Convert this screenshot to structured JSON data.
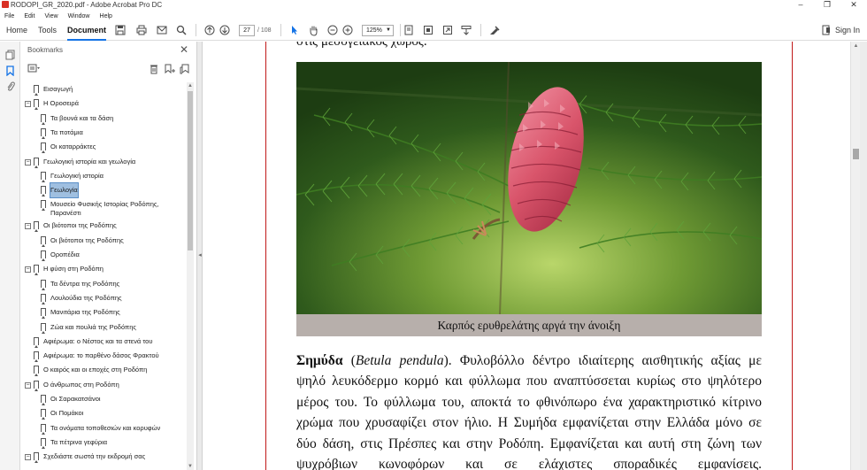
{
  "window": {
    "title": "RODOPI_GR_2020.pdf - Adobe Acrobat Pro DC",
    "minimize": "–",
    "maximize": "❐",
    "close": "✕"
  },
  "menu": [
    "File",
    "Edit",
    "View",
    "Window",
    "Help"
  ],
  "toolbar": {
    "tabs": [
      "Home",
      "Tools",
      "Document"
    ],
    "active_tab": "Document",
    "page_current": "27",
    "page_total": "/ 108",
    "zoom": "125%",
    "sign_in": "Sign In"
  },
  "bookmarks": {
    "title": "Bookmarks",
    "items": [
      {
        "label": "Εισαγωγή",
        "level": 0,
        "toggle": ""
      },
      {
        "label": "Η Οροσειρά",
        "level": 0,
        "toggle": "−"
      },
      {
        "label": "Τα βουνά και τα δάση",
        "level": 1,
        "toggle": ""
      },
      {
        "label": "Τα ποτάμια",
        "level": 1,
        "toggle": ""
      },
      {
        "label": "Οι καταρράκτες",
        "level": 1,
        "toggle": ""
      },
      {
        "label": "Γεωλογική ιστορία και γεωλογία",
        "level": 0,
        "toggle": "−"
      },
      {
        "label": "Γεωλογική ιστορία",
        "level": 1,
        "toggle": ""
      },
      {
        "label": "Γεωλογία",
        "level": 1,
        "toggle": "",
        "selected": true
      },
      {
        "label": "Μουσείο Φυσικής Ιστορίας Ροδόπης, Παρανέστι",
        "level": 1,
        "toggle": "",
        "multiline": true
      },
      {
        "label": "Οι βιότοποι της Ροδόπης",
        "level": 0,
        "toggle": "−"
      },
      {
        "label": "Οι βιότοποι της Ροδόπης",
        "level": 1,
        "toggle": ""
      },
      {
        "label": "Οροπέδια",
        "level": 1,
        "toggle": ""
      },
      {
        "label": "Η φύση στη Ροδόπη",
        "level": 0,
        "toggle": "−"
      },
      {
        "label": "Τα δέντρα της Ροδόπης",
        "level": 1,
        "toggle": ""
      },
      {
        "label": "Λουλούδια της Ροδόπης",
        "level": 1,
        "toggle": ""
      },
      {
        "label": "Μανιτάρια της Ροδόπης",
        "level": 1,
        "toggle": ""
      },
      {
        "label": "Ζώα και πουλιά της Ροδόπης",
        "level": 1,
        "toggle": ""
      },
      {
        "label": "Αφιέρωμα: ο Νέστος και τα στενά του",
        "level": 0,
        "toggle": ""
      },
      {
        "label": "Αφιέρωμα: το παρθένο δάσος Φρακτού",
        "level": 0,
        "toggle": ""
      },
      {
        "label": "Ο καιρός και οι εποχές στη Ροδόπη",
        "level": 0,
        "toggle": ""
      },
      {
        "label": "Ο άνθρωπος στη Ροδόπη",
        "level": 0,
        "toggle": "−"
      },
      {
        "label": "Οι Σαρακατσάνοι",
        "level": 1,
        "toggle": ""
      },
      {
        "label": "Οι Πομάκοι",
        "level": 1,
        "toggle": ""
      },
      {
        "label": "Τα ονόματα τοποθεσιών και κορυφών",
        "level": 1,
        "toggle": ""
      },
      {
        "label": "Τα πέτρινα γεφύρια",
        "level": 1,
        "toggle": ""
      },
      {
        "label": "Σχεδιάστε σωστά την εκδρομή σας",
        "level": 0,
        "toggle": "−"
      }
    ]
  },
  "document": {
    "top_line": "στις μεσογειακός χώρος.",
    "caption": "Καρπός ερυθρελάτης αργά την άνοιξη",
    "paragraph": {
      "term": "Σημύδα",
      "open_paren": " (",
      "latin": "Betula pendula",
      "line1_rest": "). Φυλοβόλλο δέντρο ιδιαίτερης αισθητικής αξίας με",
      "line2": "ψηλό λευκόδερμο κορμό και φύλλωμα που αναπτύσσεται κυρίως στο ψηλότερο",
      "line3": "μέρος του. Το φύλλωμα του, αποκτά το φθινόπωρο ένα χαρακτηριστικό κίτρινο",
      "line4": "χρώμα που χρυσαφίζει στον ήλιο. Η Συμήδα εμφανίζεται στην Ελλάδα μόνο σε",
      "line5": "δύο δάση, στις Πρέσπες και στην Ροδόπη. Εμφανίζεται και αυτή στη ζώνη των",
      "line6": "ψυχρόβιων κωνοφόρων και σε ελάχιστες σποραδικές εμφανίσεις."
    }
  },
  "colors": {
    "accent": "#1473e6",
    "page_border": "#c01818",
    "caption_bg": "#b7afab",
    "selection": "#9fbfe0"
  }
}
